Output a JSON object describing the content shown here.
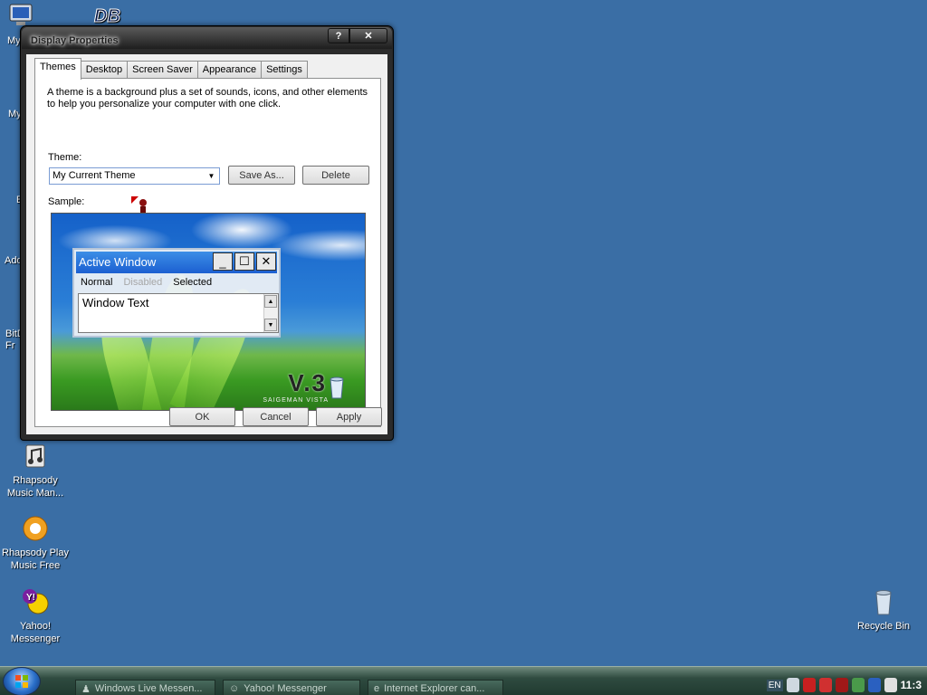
{
  "desktop": {
    "icons": [
      {
        "id": "my-computer",
        "label": "My",
        "icon": "computer-icon"
      },
      {
        "id": "db-app",
        "label": "",
        "icon": "db-logo-icon"
      },
      {
        "id": "my-documents",
        "label": "My",
        "icon": "documents-icon"
      },
      {
        "id": "internet",
        "label": "E",
        "icon": "internet-icon"
      },
      {
        "id": "add",
        "label": "Add",
        "icon": "app-icon"
      },
      {
        "id": "bitdefender",
        "label": "BitD\nFr",
        "icon": "bitdefender-icon"
      },
      {
        "id": "rhapsody-mm",
        "label": "Rhapsody Music Man...",
        "icon": "rhapsody-music-manager-icon"
      },
      {
        "id": "rhapsody-play",
        "label": "Rhapsody Play Music Free",
        "icon": "rhapsody-icon"
      },
      {
        "id": "yahoo",
        "label": "Yahoo! Messenger",
        "icon": "yahoo-messenger-icon"
      },
      {
        "id": "recycle",
        "label": "Recycle Bin",
        "icon": "recycle-bin-icon"
      }
    ]
  },
  "dialog": {
    "title": "Display Properties",
    "help_label": "?",
    "close_label": "✕",
    "tabs": [
      "Themes",
      "Desktop",
      "Screen Saver",
      "Appearance",
      "Settings"
    ],
    "active_tab": "Themes",
    "description": "A theme is a background plus a set of sounds, icons, and other elements to help you personalize your computer with one click.",
    "theme_label": "Theme:",
    "theme_value": "My Current Theme",
    "save_as_label": "Save As...",
    "delete_label": "Delete",
    "sample_label": "Sample:",
    "sample": {
      "window_title": "Active Window",
      "menu_normal": "Normal",
      "menu_disabled": "Disabled",
      "menu_selected": "Selected",
      "window_text": "Window Text",
      "logo_text": "V.3",
      "logo_subtext": "SAIGEMAN VISTA"
    },
    "ok_label": "OK",
    "cancel_label": "Cancel",
    "apply_label": "Apply"
  },
  "taskbar": {
    "tasks": [
      {
        "label": "Windows Live Messen...",
        "icon": "messenger-icon"
      },
      {
        "label": "Yahoo! Messenger",
        "icon": "yahoo-icon"
      },
      {
        "label": "Internet Explorer can...",
        "icon": "ie-icon"
      }
    ],
    "language": "EN",
    "clock": "11:3"
  },
  "colors": {
    "desktop": "#3a6ea5",
    "title_bar": "#1c5fd1",
    "taskbar": "#2f4b40"
  }
}
